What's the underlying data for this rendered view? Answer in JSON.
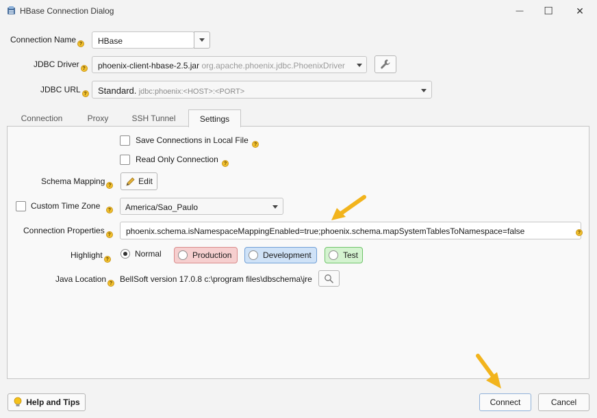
{
  "window": {
    "title": "HBase Connection Dialog",
    "minimize_glyph": "—",
    "maximize_glyph": "☐",
    "close_glyph": "✕"
  },
  "connection_name": {
    "label": "Connection Name",
    "value": "HBase"
  },
  "jdbc_driver": {
    "label": "JDBC Driver",
    "jar": "phoenix-client-hbase-2.5.jar",
    "class_name": "org.apache.phoenix.jdbc.PhoenixDriver"
  },
  "jdbc_url": {
    "label": "JDBC URL",
    "type": "Standard.",
    "template": "jdbc:phoenix:<HOST>:<PORT>"
  },
  "tabs": [
    {
      "label": "Connection",
      "active": false
    },
    {
      "label": "Proxy",
      "active": false
    },
    {
      "label": "SSH Tunnel",
      "active": false
    },
    {
      "label": "Settings",
      "active": true
    }
  ],
  "settings": {
    "save_connections_label": "Save Connections in Local File",
    "read_only_label": "Read Only Connection",
    "schema_mapping_label": "Schema Mapping",
    "edit_button_label": "Edit",
    "custom_time_zone_label": "Custom Time Zone",
    "time_zone_value": "America/Sao_Paulo",
    "connection_properties_label": "Connection Properties",
    "connection_properties_value": "phoenix.schema.isNamespaceMappingEnabled=true;phoenix.schema.mapSystemTablesToNamespace=false",
    "highlight_label": "Highlight",
    "highlight_options": [
      "Normal",
      "Production",
      "Development",
      "Test"
    ],
    "highlight_selected": "Normal",
    "java_location_label": "Java Location",
    "java_location_value": "BellSoft version 17.0.8 c:\\program files\\dbschema\\jre"
  },
  "footer": {
    "help_button_label": "Help and Tips",
    "connect_button_label": "Connect",
    "cancel_button_label": "Cancel"
  },
  "colors": {
    "production_bg": "#f6cfcf",
    "production_border": "#d98a8a",
    "development_bg": "#cfe2f7",
    "development_border": "#6f9fd6",
    "test_bg": "#d4f3d0",
    "test_border": "#6fc46a",
    "arrow": "#f2b41d"
  },
  "icons": [
    "app-icon",
    "help-icon",
    "wrench-icon",
    "pencil-icon",
    "search-icon",
    "lightbulb-icon",
    "arrow-annotation"
  ]
}
